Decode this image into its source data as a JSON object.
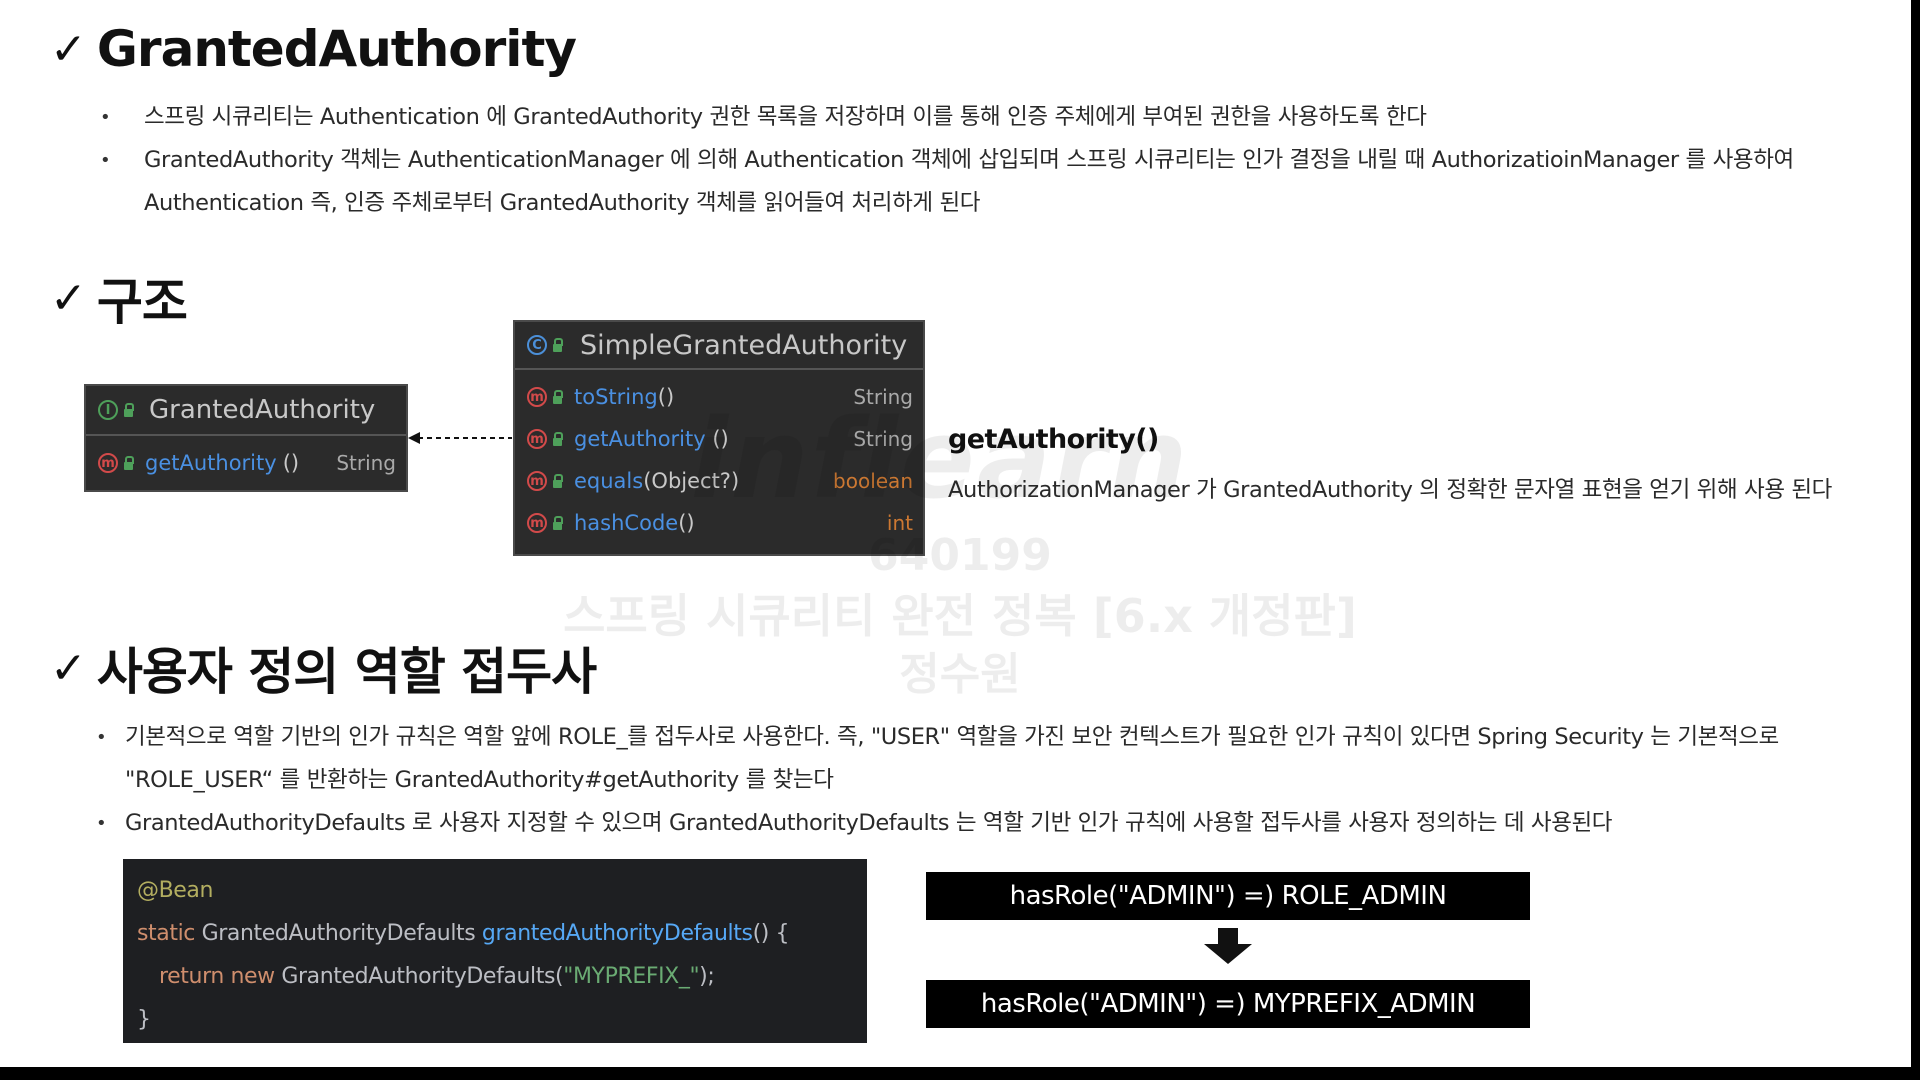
{
  "sections": {
    "granted_authority": {
      "check": "✓",
      "title": "GrantedAuthority",
      "bullets": [
        "스프링 시큐리티는 Authentication 에 GrantedAuthority 권한 목록을 저장하며 이를 통해 인증 주체에게 부여된 권한을 사용하도록 한다",
        "GrantedAuthority 객체는 AuthenticationManager 에 의해 Authentication 객체에 삽입되며 스프링 시큐리티는 인가 결정을 내릴 때 AuthorizatioinManager 를 사용하여 Authentication 즉, 인증 주체로부터 GrantedAuthority 객체를 읽어들여 처리하게 된다"
      ]
    },
    "structure": {
      "check": "✓",
      "title": "구조",
      "interface_box": {
        "badge": "I",
        "name": "GrantedAuthority",
        "methods": [
          {
            "badge": "m",
            "name": "getAuthority",
            "parens": "()",
            "type": "String"
          }
        ]
      },
      "class_box": {
        "badge": "C",
        "name": "SimpleGrantedAuthority",
        "methods": [
          {
            "badge": "m",
            "name": "toString",
            "parens": "()",
            "type": "String"
          },
          {
            "badge": "m",
            "name": "getAuthority",
            "parens": " ()",
            "type": "String"
          },
          {
            "badge": "m",
            "name": "equals",
            "parens": "(Object?)",
            "type": "boolean"
          },
          {
            "badge": "m",
            "name": "hashCode",
            "parens": "()",
            "type": "int"
          }
        ]
      },
      "method_title": "getAuthority()",
      "method_desc": "AuthorizationManager 가 GrantedAuthority 의 정확한 문자열 표현을 얻기 위해 사용 된다"
    },
    "custom_prefix": {
      "check": "✓",
      "title": "사용자 정의 역할 접두사",
      "bullets": [
        "기본적으로 역할 기반의 인가 규칙은 역할 앞에 ROLE_를 접두사로 사용한다. 즉, \"USER\" 역할을 가진 보안 컨텍스트가 필요한 인가 규칙이 있다면 Spring Security 는 기본적으로 \"ROLE_USER“ 를 반환하는 GrantedAuthority#getAuthority 를 찾는다",
        "GrantedAuthorityDefaults 로 사용자 지정할 수 있으며 GrantedAuthorityDefaults 는 역할 기반 인가 규칙에 사용할 접두사를 사용자 정의하는 데 사용된다"
      ],
      "code": {
        "line1_annotation": "@Bean",
        "line2_kw": "static ",
        "line2_type": "GrantedAuthorityDefaults ",
        "line2_fn": "grantedAuthorityDefaults",
        "line2_rest": "() {",
        "line3_kw": "return new ",
        "line3_type": "GrantedAuthorityDefaults(",
        "line3_str": "\"MYPREFIX_\"",
        "line3_rest": ");",
        "line4": "}"
      },
      "role_before": "hasRole(\"ADMIN\") =) ROLE_ADMIN",
      "role_after": "hasRole(\"ADMIN\") =) MYPREFIX_ADMIN"
    }
  },
  "watermark": {
    "logo": "inflearn",
    "id": "640199",
    "course": "스프링 시큐리티 완전 정복 [6.x 개정판]",
    "author": "정수원"
  }
}
